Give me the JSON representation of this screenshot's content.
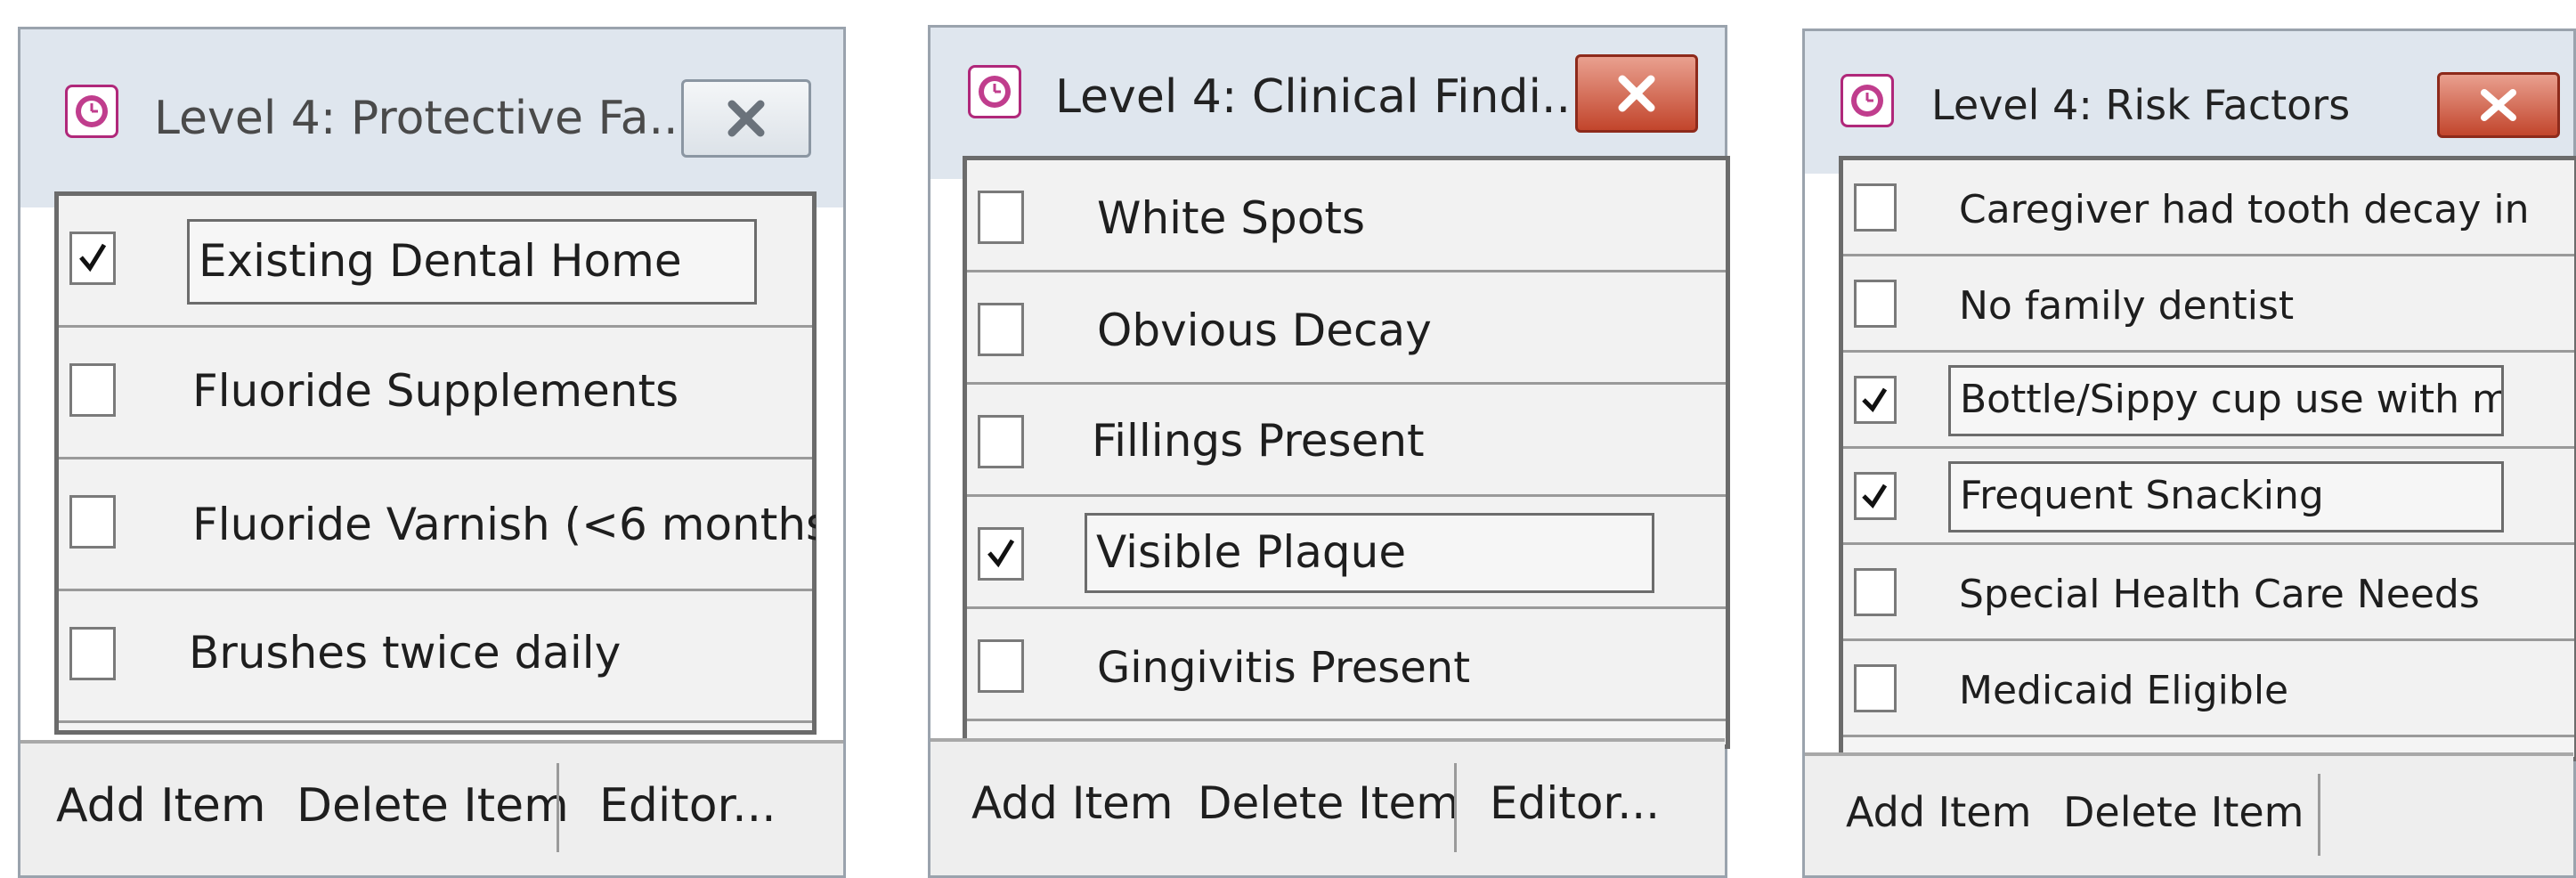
{
  "panels": [
    {
      "title": "Level 4: Protective Fa...",
      "close_label": "X",
      "items": [
        {
          "label": "Existing Dental Home",
          "checked": true
        },
        {
          "label": "Fluoride Supplements",
          "checked": false
        },
        {
          "label": "Fluoride Varnish (<6 months",
          "checked": false
        },
        {
          "label": "Brushes twice daily",
          "checked": false
        }
      ],
      "buttons": {
        "add": "Add Item",
        "delete": "Delete Item",
        "editor": "Editor..."
      }
    },
    {
      "title": "Level 4: Clinical Findi...",
      "close_label": "X",
      "items": [
        {
          "label": "White Spots",
          "checked": false
        },
        {
          "label": "Obvious Decay",
          "checked": false
        },
        {
          "label": "Fillings Present",
          "checked": false
        },
        {
          "label": "Visible Plaque",
          "checked": true
        },
        {
          "label": "Gingivitis Present",
          "checked": false
        }
      ],
      "buttons": {
        "add": "Add Item",
        "delete": "Delete Item",
        "editor": "Editor..."
      }
    },
    {
      "title": "Level 4: Risk Factors",
      "close_label": "X",
      "items": [
        {
          "label": "Caregiver had tooth decay in",
          "checked": false
        },
        {
          "label": "No family dentist",
          "checked": false
        },
        {
          "label": "Bottle/Sippy cup use with mi",
          "checked": true
        },
        {
          "label": "Frequent Snacking",
          "checked": true
        },
        {
          "label": "Special Health Care Needs",
          "checked": false
        },
        {
          "label": "Medicaid Eligible",
          "checked": false
        }
      ],
      "buttons": {
        "add": "Add Item",
        "delete": "Delete Item"
      }
    }
  ]
}
